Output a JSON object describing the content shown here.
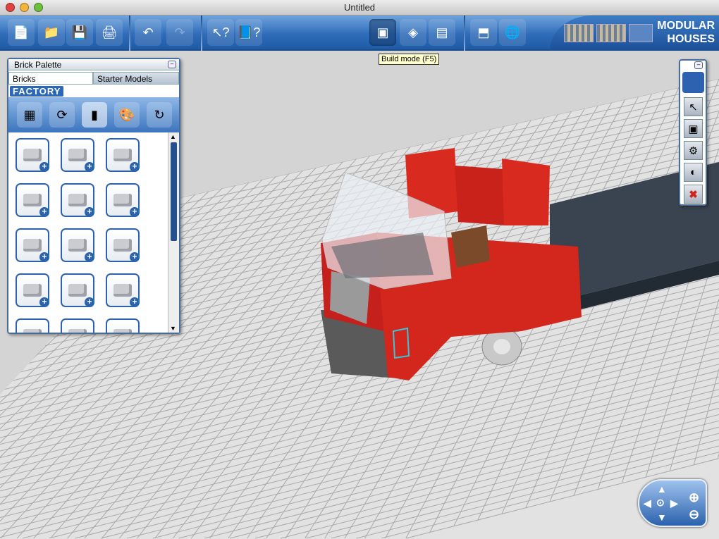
{
  "window": {
    "title": "Untitled"
  },
  "toolbar": {
    "buttons": [
      {
        "name": "new-file",
        "glyph": "📄"
      },
      {
        "name": "open-folder",
        "glyph": "📁"
      },
      {
        "name": "save",
        "glyph": "💾"
      },
      {
        "name": "print",
        "glyph": "🖨"
      },
      {
        "name": "undo",
        "glyph": "↶"
      },
      {
        "name": "redo",
        "glyph": "↷"
      },
      {
        "name": "pointer-help",
        "glyph": "↖?"
      },
      {
        "name": "book-help",
        "glyph": "📘?"
      },
      {
        "name": "build-mode",
        "glyph": "▣"
      },
      {
        "name": "view-mode",
        "glyph": "◈"
      },
      {
        "name": "building-guide-mode",
        "glyph": "▤"
      },
      {
        "name": "export-brick",
        "glyph": "⬒"
      },
      {
        "name": "share-online",
        "glyph": "🌐"
      }
    ],
    "brand": "MODULAR HOUSES",
    "tooltip": "Build mode (F5)"
  },
  "palette": {
    "title": "Brick Palette",
    "tabs": [
      "Bricks",
      "Starter Models"
    ],
    "theme": "FACTORY",
    "categories": [
      "brick-category",
      "rotate-category",
      "colour-category",
      "paint-category",
      "refresh-category"
    ]
  },
  "colors": {
    "toolbar": "#2f6cb9",
    "brick_red": "#d0231c",
    "plate_grey": "#3a4450",
    "floor": "#d4d4d4"
  }
}
